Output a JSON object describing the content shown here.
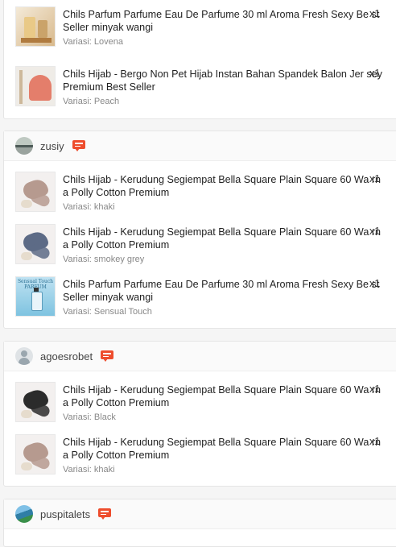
{
  "groups": [
    {
      "user": null,
      "items": [
        {
          "title": "Chils Parfum Parfume Eau De Parfume 30 ml Aroma Fresh Sexy Be st Seller minyak wangi",
          "variant": "Variasi: Lovena",
          "qty": "x1",
          "edge": "S",
          "thumb_icon": "parfum-icon"
        },
        {
          "title": "Chils Hijab - Bergo Non Pet Hijab Instan Bahan Spandek Balon Jer sey Premium Best Seller",
          "variant": "Variasi: Peach",
          "qty": "x1",
          "edge": "",
          "thumb_icon": "hijab-icon"
        }
      ]
    },
    {
      "user": "zusiy",
      "items": [
        {
          "title": "Chils Hijab - Kerudung Segiempat Bella Square Plain Square 60 Wa rna Polly Cotton Premium",
          "variant": "Variasi: khaki",
          "qty": "x1",
          "edge": "S",
          "thumb_icon": "hijab-icon"
        },
        {
          "title": "Chils Hijab - Kerudung Segiempat Bella Square Plain Square 60 Wa rna Polly Cotton Premium",
          "variant": "Variasi: smokey grey",
          "qty": "x1",
          "edge": "",
          "thumb_icon": "hijab-icon"
        },
        {
          "title": "Chils Parfum Parfume Eau De Parfume 30 ml Aroma Fresh Sexy Be st Seller minyak wangi",
          "variant": "Variasi: Sensual Touch",
          "qty": "x1",
          "edge": "",
          "thumb_icon": "parfum-icon",
          "thumb_text": "Sensual Touch PARFUM"
        }
      ]
    },
    {
      "user": "agoesrobet",
      "items": [
        {
          "title": "Chils Hijab - Kerudung Segiempat Bella Square Plain Square 60 Wa rna Polly Cotton Premium",
          "variant": "Variasi: Black",
          "qty": "x1",
          "edge": "",
          "thumb_icon": "hijab-icon"
        },
        {
          "title": "Chils Hijab - Kerudung Segiempat Bella Square Plain Square 60 Wa rna Polly Cotton Premium",
          "variant": "Variasi: khaki",
          "qty": "x1",
          "edge": "",
          "thumb_icon": "hijab-icon"
        }
      ]
    },
    {
      "user": "puspitalets",
      "items": []
    }
  ],
  "colors": {
    "accent": "#ee4d2d",
    "text": "#222222",
    "muted": "#888888"
  },
  "icons": {
    "chat": "chat-icon",
    "avatar": "avatar-icon"
  }
}
